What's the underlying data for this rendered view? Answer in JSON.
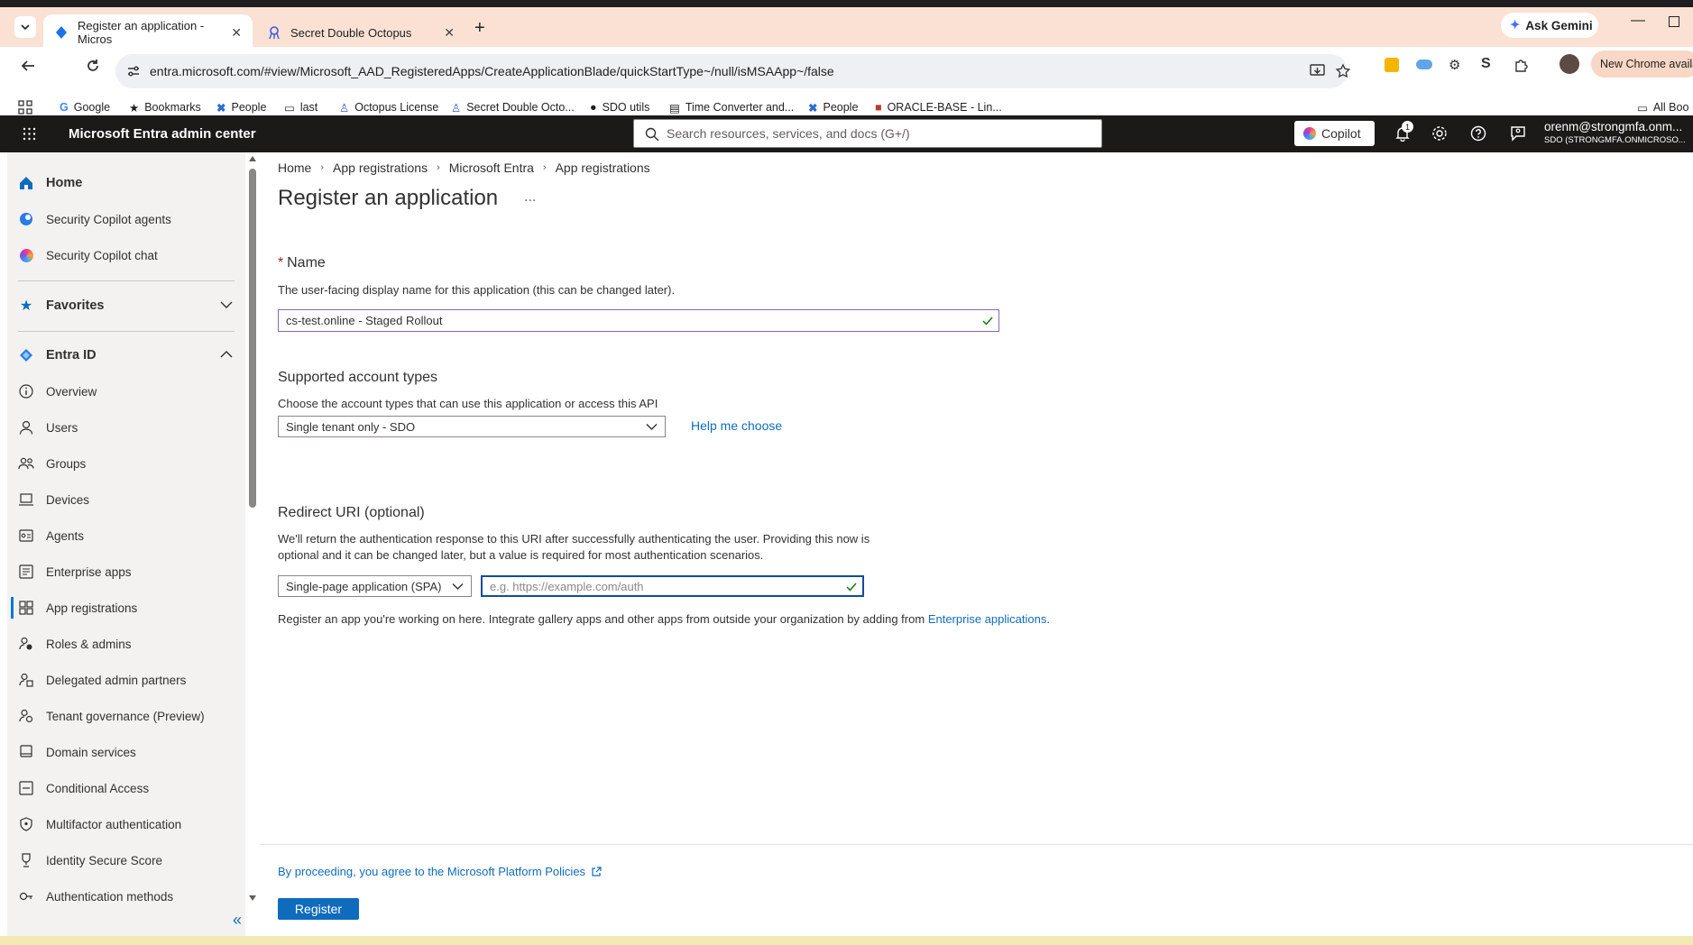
{
  "browser": {
    "tabs": [
      {
        "title": "Register an application - Micros"
      },
      {
        "title": "Secret Double Octopus"
      }
    ],
    "ask_gemini": "Ask Gemini",
    "url": "entra.microsoft.com/#view/Microsoft_AAD_RegisteredApps/CreateApplicationBlade/quickStartType~/null/isMSAApp~/false",
    "new_chrome": "New Chrome availa",
    "bookmarks": [
      {
        "label": "Google"
      },
      {
        "label": "Bookmarks"
      },
      {
        "label": "People"
      },
      {
        "label": "last"
      },
      {
        "label": "Octopus License"
      },
      {
        "label": "Secret Double Octo..."
      },
      {
        "label": "SDO utils"
      },
      {
        "label": "Time Converter and..."
      },
      {
        "label": "People"
      },
      {
        "label": "ORACLE-BASE - Lin..."
      }
    ],
    "all_bookmarks": "All Boo"
  },
  "header": {
    "app_title": "Microsoft Entra admin center",
    "search_placeholder": "Search resources, services, and docs (G+/)",
    "copilot": "Copilot",
    "notification_count": "1",
    "user_email": "orenm@strongmfa.onm...",
    "user_tenant": "SDO (STRONGMFA.ONMICROSO..."
  },
  "sidebar": {
    "home": "Home",
    "security_copilot_agents": "Security Copilot agents",
    "security_copilot_chat": "Security Copilot chat",
    "favorites": "Favorites",
    "entra_id": "Entra ID",
    "items": [
      {
        "label": "Overview"
      },
      {
        "label": "Users"
      },
      {
        "label": "Groups"
      },
      {
        "label": "Devices"
      },
      {
        "label": "Agents"
      },
      {
        "label": "Enterprise apps"
      },
      {
        "label": "App registrations"
      },
      {
        "label": "Roles & admins"
      },
      {
        "label": "Delegated admin partners"
      },
      {
        "label": "Tenant governance (Preview)"
      },
      {
        "label": "Domain services"
      },
      {
        "label": "Conditional Access"
      },
      {
        "label": "Multifactor authentication"
      },
      {
        "label": "Identity Secure Score"
      },
      {
        "label": "Authentication methods"
      }
    ],
    "collapse_glyph": "«"
  },
  "breadcrumb": [
    "Home",
    "App registrations",
    "Microsoft Entra",
    "App registrations"
  ],
  "page": {
    "title": "Register an application",
    "more": "...",
    "name_label": "Name",
    "required_mark": "*",
    "name_desc": "The user-facing display name for this application (this can be changed later).",
    "name_value": "cs-test.online - Staged Rollout",
    "account_types_label": "Supported account types",
    "account_types_desc": "Choose the account types that can use this application or access this API",
    "account_types_value": "Single tenant only - SDO",
    "help_me_choose": "Help me choose",
    "redirect_label": "Redirect URI (optional)",
    "redirect_desc_1": "We'll return the authentication response to this URI after successfully authenticating the user. Providing this now is",
    "redirect_desc_2": "optional and it can be changed later, but a value is required for most authentication scenarios.",
    "platform_value": "Single-page application (SPA)",
    "redirect_placeholder": "e.g. https://example.com/auth",
    "register_note": "Register an app you're working on here. Integrate gallery apps and other apps from outside your organization by adding from",
    "enterprise_link": "Enterprise applications",
    "period": ".",
    "policies_link": "By proceeding, you agree to the Microsoft Platform Policies",
    "register_button": "Register"
  },
  "colors": {
    "accent": "#0f6cbd",
    "tabstrip": "#fae1d4",
    "header_bg": "#1b1a19",
    "sidebar_bg": "#f3f2f1"
  }
}
